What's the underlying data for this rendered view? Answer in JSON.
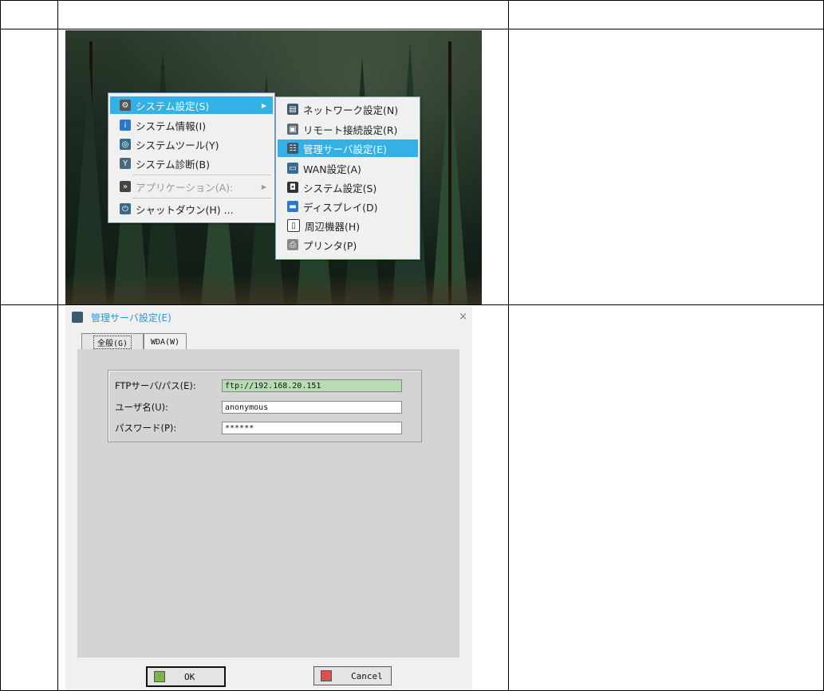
{
  "menu": {
    "items": [
      {
        "label": "システム設定(S)",
        "icon": "gear-icon",
        "selected": true,
        "has_submenu": true
      },
      {
        "label": "システム情報(I)",
        "icon": "info-icon"
      },
      {
        "label": "システムツール(Y)",
        "icon": "tool-icon"
      },
      {
        "label": "システム診断(B)",
        "icon": "diagnosis-icon"
      },
      {
        "label": "アプリケーション(A):",
        "icon": "app-icon",
        "disabled": true,
        "has_submenu": true
      },
      {
        "label": "シャットダウン(H) ...",
        "icon": "power-icon"
      }
    ]
  },
  "submenu": {
    "items": [
      {
        "label": "ネットワーク設定(N)",
        "icon": "network-icon"
      },
      {
        "label": "リモート接続設定(R)",
        "icon": "remote-icon"
      },
      {
        "label": "管理サーバ設定(E)",
        "icon": "server-icon",
        "selected": true
      },
      {
        "label": "WAN設定(A)",
        "icon": "wan-icon"
      },
      {
        "label": "システム設定(S)",
        "icon": "system-icon"
      },
      {
        "label": "ディスプレイ(D)",
        "icon": "display-icon"
      },
      {
        "label": "周辺機器(H)",
        "icon": "mouse-icon"
      },
      {
        "label": "プリンタ(P)",
        "icon": "printer-icon"
      }
    ]
  },
  "dialog": {
    "title": "管理サーバ設定(E)",
    "close": "×",
    "tabs": [
      {
        "label": "全般(G)",
        "active": true
      },
      {
        "label": "WDA(W)"
      }
    ],
    "fields": [
      {
        "label": "FTPサーバ/パス(E):",
        "value": "ftp://192.168.20.151"
      },
      {
        "label": "ユーザ名(U):",
        "value": "anonymous"
      },
      {
        "label": "パスワード(P):",
        "value": "******"
      }
    ],
    "ok": "OK",
    "cancel": "Cancel"
  },
  "colors": {
    "accent": "#33b0e6",
    "field_highlight": "#b7dbb2",
    "title": "#2f93d6"
  }
}
